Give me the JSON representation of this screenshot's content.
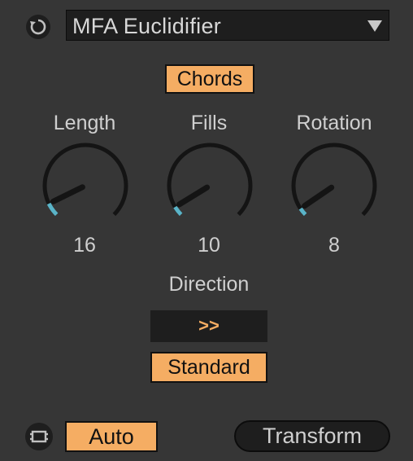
{
  "device": {
    "preset_name": "MFA Euclidifier",
    "refresh_icon": "refresh-icon",
    "dropdown_icon": "triangle-down-icon"
  },
  "chords_button": "Chords",
  "knobs": [
    {
      "label": "Length",
      "value": "16",
      "fraction": 0.07
    },
    {
      "label": "Fills",
      "value": "10",
      "fraction": 0.05
    },
    {
      "label": "Rotation",
      "value": "8",
      "fraction": 0.04
    }
  ],
  "direction": {
    "label": "Direction",
    "value": ">>",
    "mode_button": "Standard"
  },
  "footer": {
    "auto_icon": "loop-icon",
    "auto_button": "Auto",
    "transform_button": "Transform"
  },
  "colors": {
    "background": "#363636",
    "accent": "#f5ad63",
    "knob_fill": "#5ab4c8",
    "dark": "#1e1e1e"
  }
}
